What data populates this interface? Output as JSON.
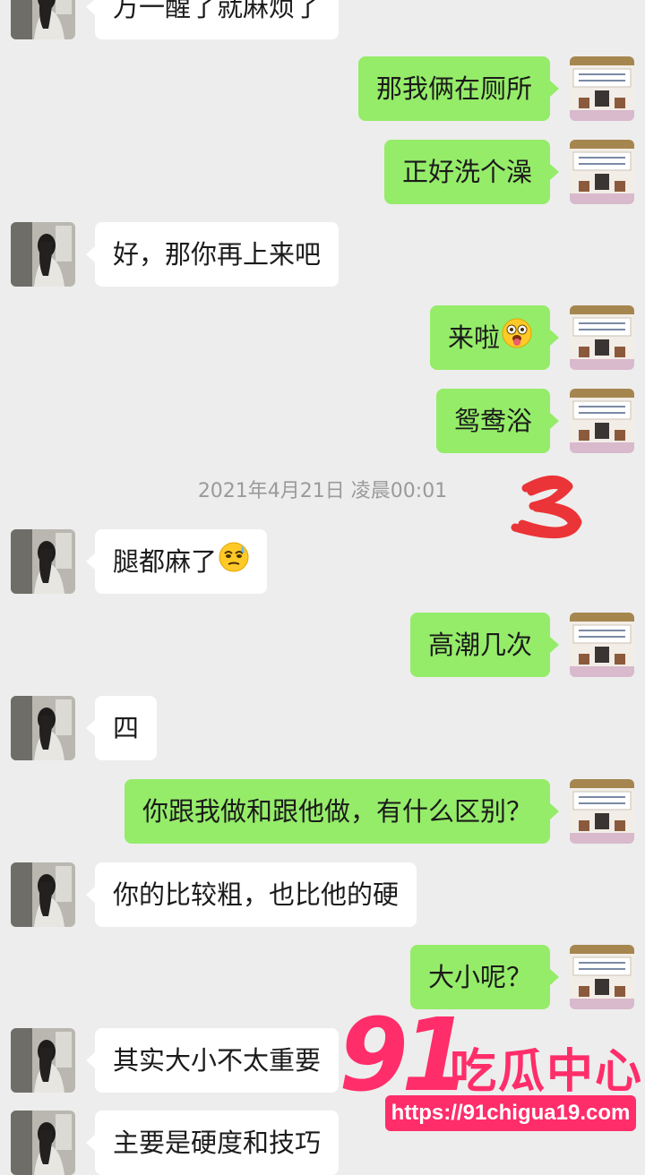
{
  "colors": {
    "background": "#ededed",
    "sent_bubble": "#95ec69",
    "received_bubble": "#ffffff",
    "timestamp_text": "#9a9a9a",
    "watermark": "#ff2d6a"
  },
  "messages": [
    {
      "side": "left",
      "text": "万一醒了就麻烦了"
    },
    {
      "side": "right",
      "text": "那我俩在厕所"
    },
    {
      "side": "right",
      "text": "正好洗个澡"
    },
    {
      "side": "left",
      "text": "好，那你再上来吧"
    },
    {
      "side": "right",
      "text": "来啦",
      "emoji": "tongue-out-emoji"
    },
    {
      "side": "right",
      "text": "鸳鸯浴"
    },
    {
      "side": "left",
      "text": "腿都麻了",
      "emoji": "sweat-face-emoji"
    },
    {
      "side": "right",
      "text": "高潮几次"
    },
    {
      "side": "left",
      "text": "四"
    },
    {
      "side": "right",
      "text": "你跟我做和跟他做，有什么区别？"
    },
    {
      "side": "left",
      "text": "你的比较粗，也比他的硬"
    },
    {
      "side": "right",
      "text": "大小呢？"
    },
    {
      "side": "left",
      "text": "其实大小不太重要"
    },
    {
      "side": "left",
      "text": "主要是硬度和技巧"
    }
  ],
  "timestamp": "2021年4月21日 凌晨00:01",
  "watermark": {
    "number": "91",
    "brand": "吃瓜中心",
    "url": "https://91chigua19.com"
  }
}
